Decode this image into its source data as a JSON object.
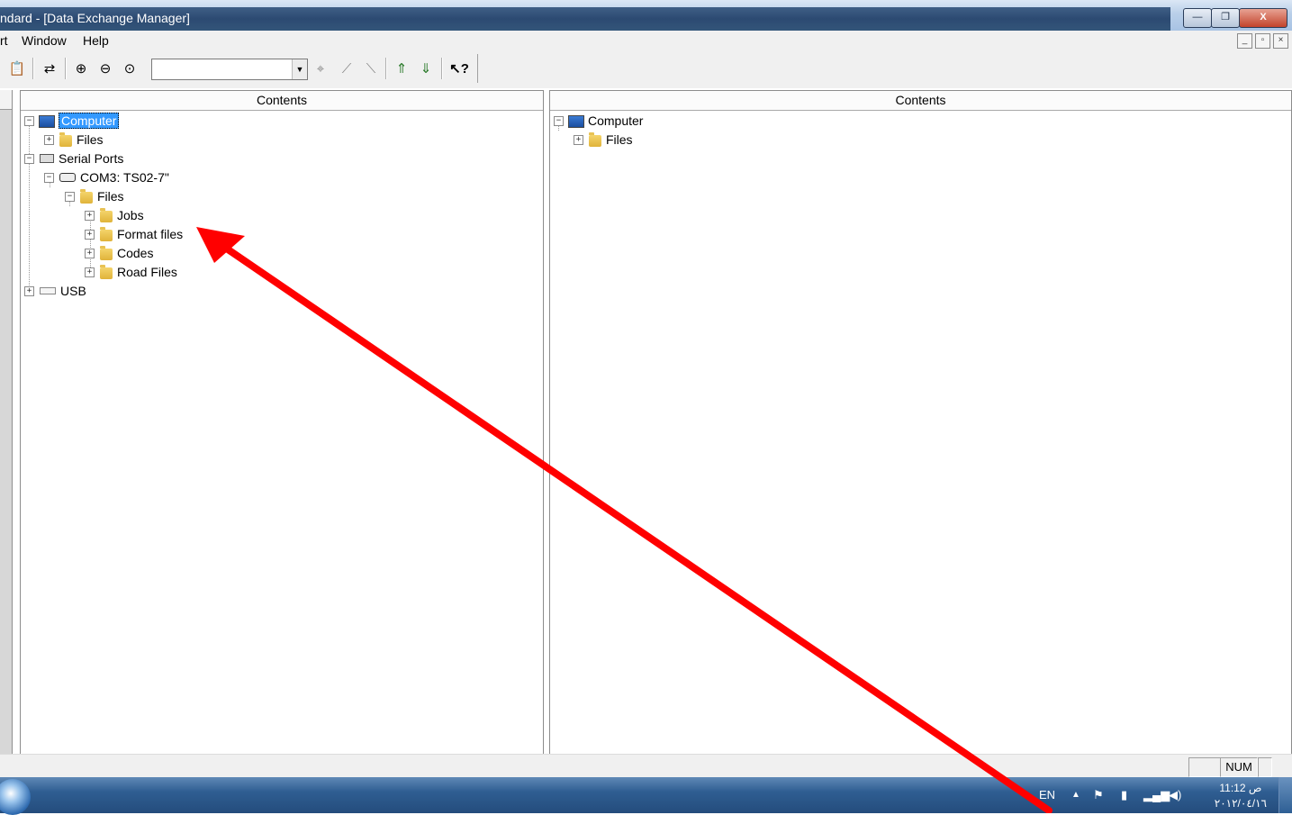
{
  "window": {
    "title": "ndard - [Data Exchange Manager]",
    "minimize": "—",
    "restore": "❐",
    "close": "X"
  },
  "menu": {
    "items": [
      "rt",
      "Window",
      "Help"
    ],
    "mdi_minimize": "_",
    "mdi_restore": "▫",
    "mdi_close": "×"
  },
  "toolbar": {
    "icons": [
      "paste-icon",
      "transfer-icon",
      "zoom-in-icon",
      "zoom-out-icon",
      "zoom-extent-icon",
      "target-icon",
      "measure-icon",
      "measure-alt-icon",
      "upload-icon",
      "download-icon",
      "help-pointer-icon"
    ],
    "combo_value": ""
  },
  "left_pane": {
    "header": "Contents",
    "tree": {
      "computer": "Computer",
      "computer_files": "Files",
      "serial_ports": "Serial Ports",
      "com3": "COM3: TS02-7\"",
      "com3_files": "Files",
      "jobs": "Jobs",
      "format_files": "Format files",
      "codes": "Codes",
      "road_files": "Road Files",
      "usb": "USB"
    }
  },
  "right_pane": {
    "header": "Contents",
    "tree": {
      "computer": "Computer",
      "files": "Files"
    }
  },
  "status": {
    "num": "NUM"
  },
  "taskbar": {
    "language": "EN",
    "tray_arrow": "▲",
    "time": "11:12 ص",
    "date": "٢٠١٢/٠٤/١٦"
  },
  "annotation": {
    "color": "#ff0000"
  }
}
